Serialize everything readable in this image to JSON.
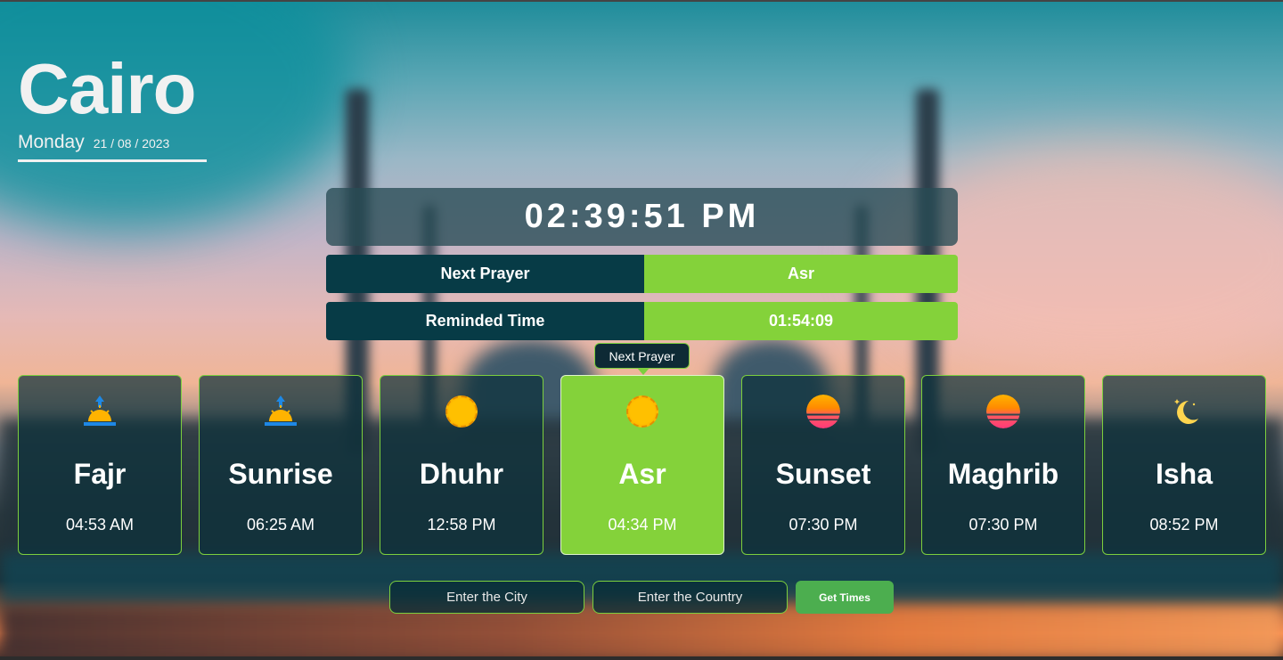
{
  "location": {
    "city": "Cairo",
    "day": "Monday",
    "date": "21 / 08 / 2023"
  },
  "clock": "02:39:51 PM",
  "next_prayer": {
    "label": "Next Prayer",
    "value": "Asr"
  },
  "remaining": {
    "label": "Reminded Time",
    "value": "01:54:09"
  },
  "tooltip": "Next Prayer",
  "prayers": [
    {
      "name": "Fajr",
      "time": "04:53 AM",
      "icon": "sunrise-icon"
    },
    {
      "name": "Sunrise",
      "time": "06:25 AM",
      "icon": "sunrise-icon"
    },
    {
      "name": "Dhuhr",
      "time": "12:58 PM",
      "icon": "sun-icon"
    },
    {
      "name": "Asr",
      "time": "04:34 PM",
      "icon": "sun-icon",
      "active": true
    },
    {
      "name": "Sunset",
      "time": "07:30 PM",
      "icon": "sunset-icon"
    },
    {
      "name": "Maghrib",
      "time": "07:30 PM",
      "icon": "sunset-icon"
    },
    {
      "name": "Isha",
      "time": "08:52 PM",
      "icon": "moon-icon"
    }
  ],
  "form": {
    "city_placeholder": "Enter the City",
    "country_placeholder": "Enter the Country",
    "submit_label": "Get Times"
  },
  "colors": {
    "accent": "#84d23a",
    "dark": "#073b46",
    "button": "#4cae4f"
  }
}
